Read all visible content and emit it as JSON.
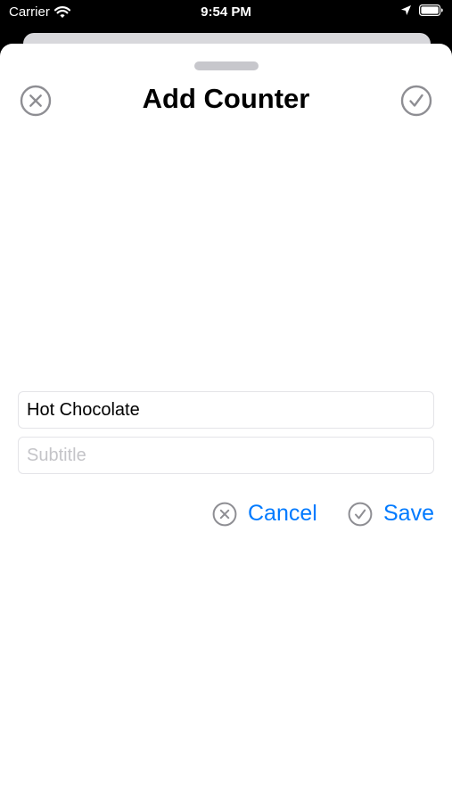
{
  "status_bar": {
    "carrier": "Carrier",
    "time": "9:54 PM",
    "wifi_icon": "wifi-icon",
    "location_icon": "location-arrow-icon",
    "battery_icon": "battery-icon"
  },
  "sheet": {
    "title": "Add Counter",
    "close_icon": "close-circle-icon",
    "confirm_icon": "checkmark-circle-icon"
  },
  "form": {
    "title_value": "Hot Chocolate",
    "title_placeholder": "",
    "subtitle_value": "",
    "subtitle_placeholder": "Subtitle"
  },
  "actions": {
    "cancel_label": "Cancel",
    "save_label": "Save"
  },
  "colors": {
    "accent": "#007aff",
    "icon_gray": "#8e8e93",
    "status_bar_bg": "#000000",
    "sheet_bg": "#ffffff"
  }
}
